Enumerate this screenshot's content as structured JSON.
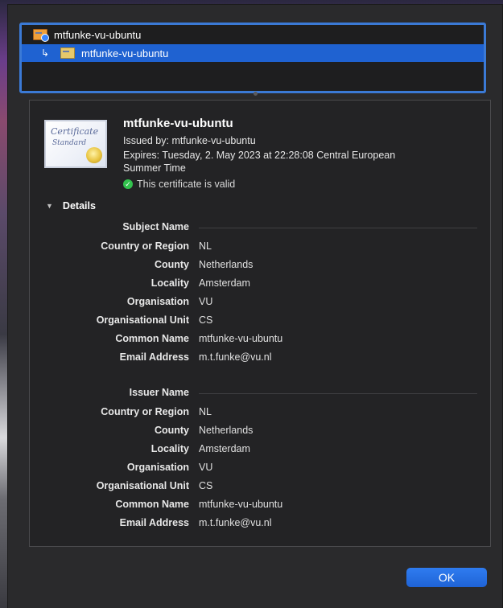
{
  "hierarchy": [
    {
      "label": "mtfunke-vu-ubuntu",
      "selected": false
    },
    {
      "label": "mtfunke-vu-ubuntu",
      "selected": true
    }
  ],
  "certificate": {
    "badge_title": "Certificate",
    "badge_subtitle": "Standard",
    "title": "mtfunke-vu-ubuntu",
    "issued_by": "Issued by: mtfunke-vu-ubuntu",
    "expires_line1": "Expires: Tuesday, 2. May 2023 at 22:28:08 Central European",
    "expires_line2": "Summer Time",
    "status": "This certificate is valid",
    "status_color": "#32c24d"
  },
  "details": {
    "toggle_label": "Details",
    "subject_header": "Subject Name",
    "subject": [
      {
        "label": "Country or Region",
        "value": "NL"
      },
      {
        "label": "County",
        "value": "Netherlands"
      },
      {
        "label": "Locality",
        "value": "Amsterdam"
      },
      {
        "label": "Organisation",
        "value": "VU"
      },
      {
        "label": "Organisational Unit",
        "value": "CS"
      },
      {
        "label": "Common Name",
        "value": "mtfunke-vu-ubuntu"
      },
      {
        "label": "Email Address",
        "value": "m.t.funke@vu.nl"
      }
    ],
    "issuer_header": "Issuer Name",
    "issuer": [
      {
        "label": "Country or Region",
        "value": "NL"
      },
      {
        "label": "County",
        "value": "Netherlands"
      },
      {
        "label": "Locality",
        "value": "Amsterdam"
      },
      {
        "label": "Organisation",
        "value": "VU"
      },
      {
        "label": "Organisational Unit",
        "value": "CS"
      },
      {
        "label": "Common Name",
        "value": "mtfunke-vu-ubuntu"
      },
      {
        "label": "Email Address",
        "value": "m.t.funke@vu.nl"
      }
    ]
  },
  "buttons": {
    "ok": "OK"
  },
  "colors": {
    "accent": "#1f62d1",
    "selection": "#1f62d1"
  }
}
